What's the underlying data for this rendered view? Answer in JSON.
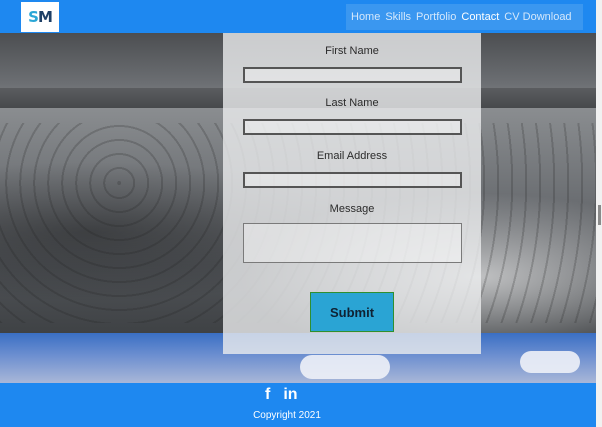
{
  "navbar": {
    "logo": "SM",
    "items": [
      {
        "label": "Home",
        "active": false
      },
      {
        "label": "Skills",
        "active": false
      },
      {
        "label": "Portfolio",
        "active": false
      },
      {
        "label": "Contact",
        "active": true
      },
      {
        "label": "CV Download",
        "active": false
      }
    ]
  },
  "form": {
    "first_name_label": "First Name",
    "first_name_value": "",
    "last_name_label": "Last Name",
    "last_name_value": "",
    "email_label": "Email Address",
    "email_value": "",
    "message_label": "Message",
    "message_value": "",
    "submit_label": "Submit"
  },
  "footer": {
    "icons": [
      "facebook-icon",
      "linkedin-icon"
    ],
    "facebook_glyph": "f",
    "linkedin_glyph": "in",
    "copyright": "Copyright 2021"
  },
  "colors": {
    "primary": "#1e88f0",
    "submit": "#2aa4d4"
  }
}
